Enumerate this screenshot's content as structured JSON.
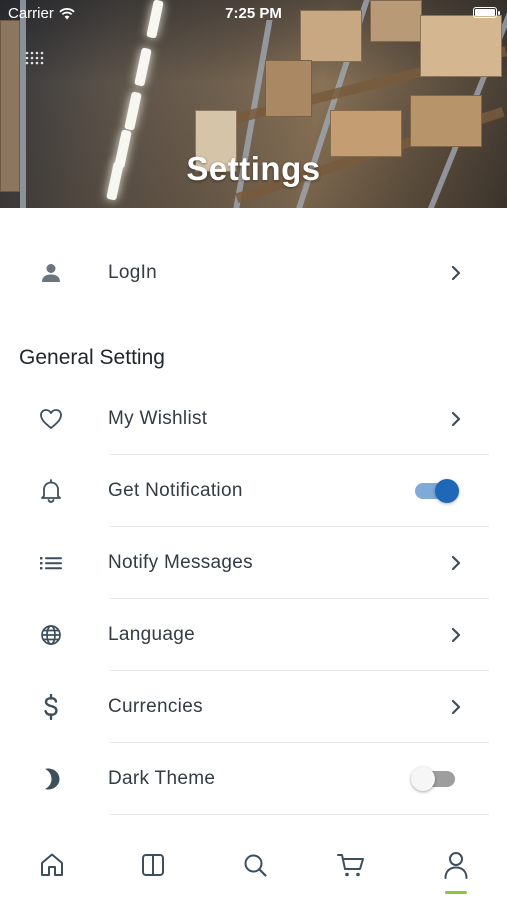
{
  "status_bar": {
    "carrier": "Carrier",
    "time": "7:25 PM"
  },
  "header": {
    "title": "Settings"
  },
  "login_row": {
    "label": "LogIn",
    "icon": "person-icon"
  },
  "section": {
    "title": "General Setting"
  },
  "settings": [
    {
      "label": "My Wishlist",
      "icon": "heart-icon",
      "control": "chevron"
    },
    {
      "label": "Get Notification",
      "icon": "bell-icon",
      "control": "toggle",
      "value": true
    },
    {
      "label": "Notify Messages",
      "icon": "list-icon",
      "control": "chevron"
    },
    {
      "label": "Language",
      "icon": "globe-icon",
      "control": "chevron"
    },
    {
      "label": "Currencies",
      "icon": "dollar-icon",
      "control": "chevron"
    },
    {
      "label": "Dark Theme",
      "icon": "moon-icon",
      "control": "toggle",
      "value": false
    }
  ],
  "tab_bar": {
    "tabs": [
      "home-icon",
      "categories-icon",
      "search-icon",
      "cart-icon",
      "profile-icon"
    ],
    "active": "profile-icon"
  },
  "colors": {
    "icon": "#3d4f5c",
    "text": "#333c44",
    "toggle_on": "#1f67b7",
    "active_tab_indicator": "#8cc63f"
  }
}
